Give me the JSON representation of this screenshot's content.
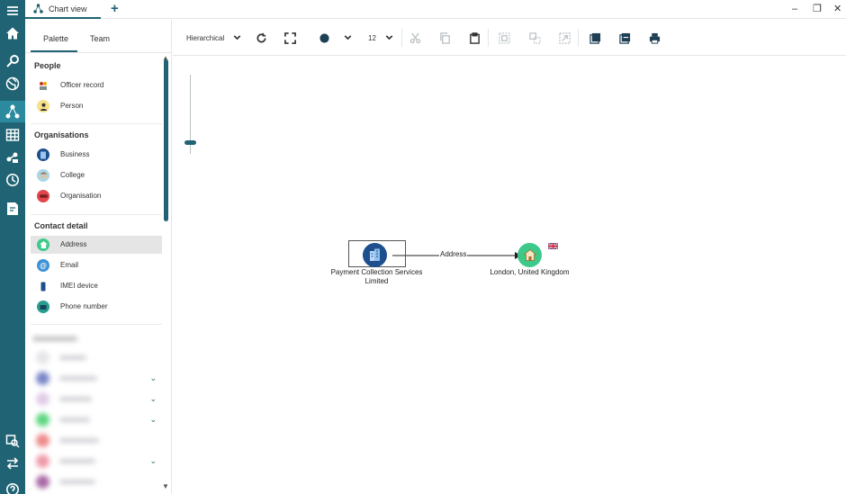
{
  "window": {
    "tab_label": "Chart view",
    "new_tab": "+",
    "minimize": "–",
    "restore": "❐",
    "close": "✕"
  },
  "rail": {
    "icons": [
      "menu-icon",
      "home-icon",
      "search-icon",
      "globe-icon",
      "chart-network-icon",
      "table-icon",
      "data-icon",
      "clock-icon",
      "report-icon",
      "inspect-icon",
      "swap-icon",
      "help-icon"
    ],
    "active": "chart-network-icon"
  },
  "panel": {
    "tabs": [
      "Palette",
      "Team"
    ],
    "sections": [
      {
        "title": "People",
        "items": [
          "Officer record",
          "Person"
        ]
      },
      {
        "title": "Organisations",
        "items": [
          "Business",
          "College",
          "Organisation"
        ]
      },
      {
        "title": "Contact detail",
        "items": [
          "Address",
          "Email",
          "IMEI device",
          "Phone number"
        ]
      }
    ],
    "selected_item": "Address"
  },
  "toolbar": {
    "layout_label": "Hierarchical",
    "size_value": "12"
  },
  "chart": {
    "source_label_line1": "Payment Collection Services",
    "source_label_line2": "Limited",
    "edge_label": "Address",
    "target_label": "London, United Kingdom"
  },
  "colors": {
    "rail": "#1f6374",
    "accent": "#1f6374",
    "business_node": "#1d4f8e",
    "address_node": "#3cc98a"
  }
}
